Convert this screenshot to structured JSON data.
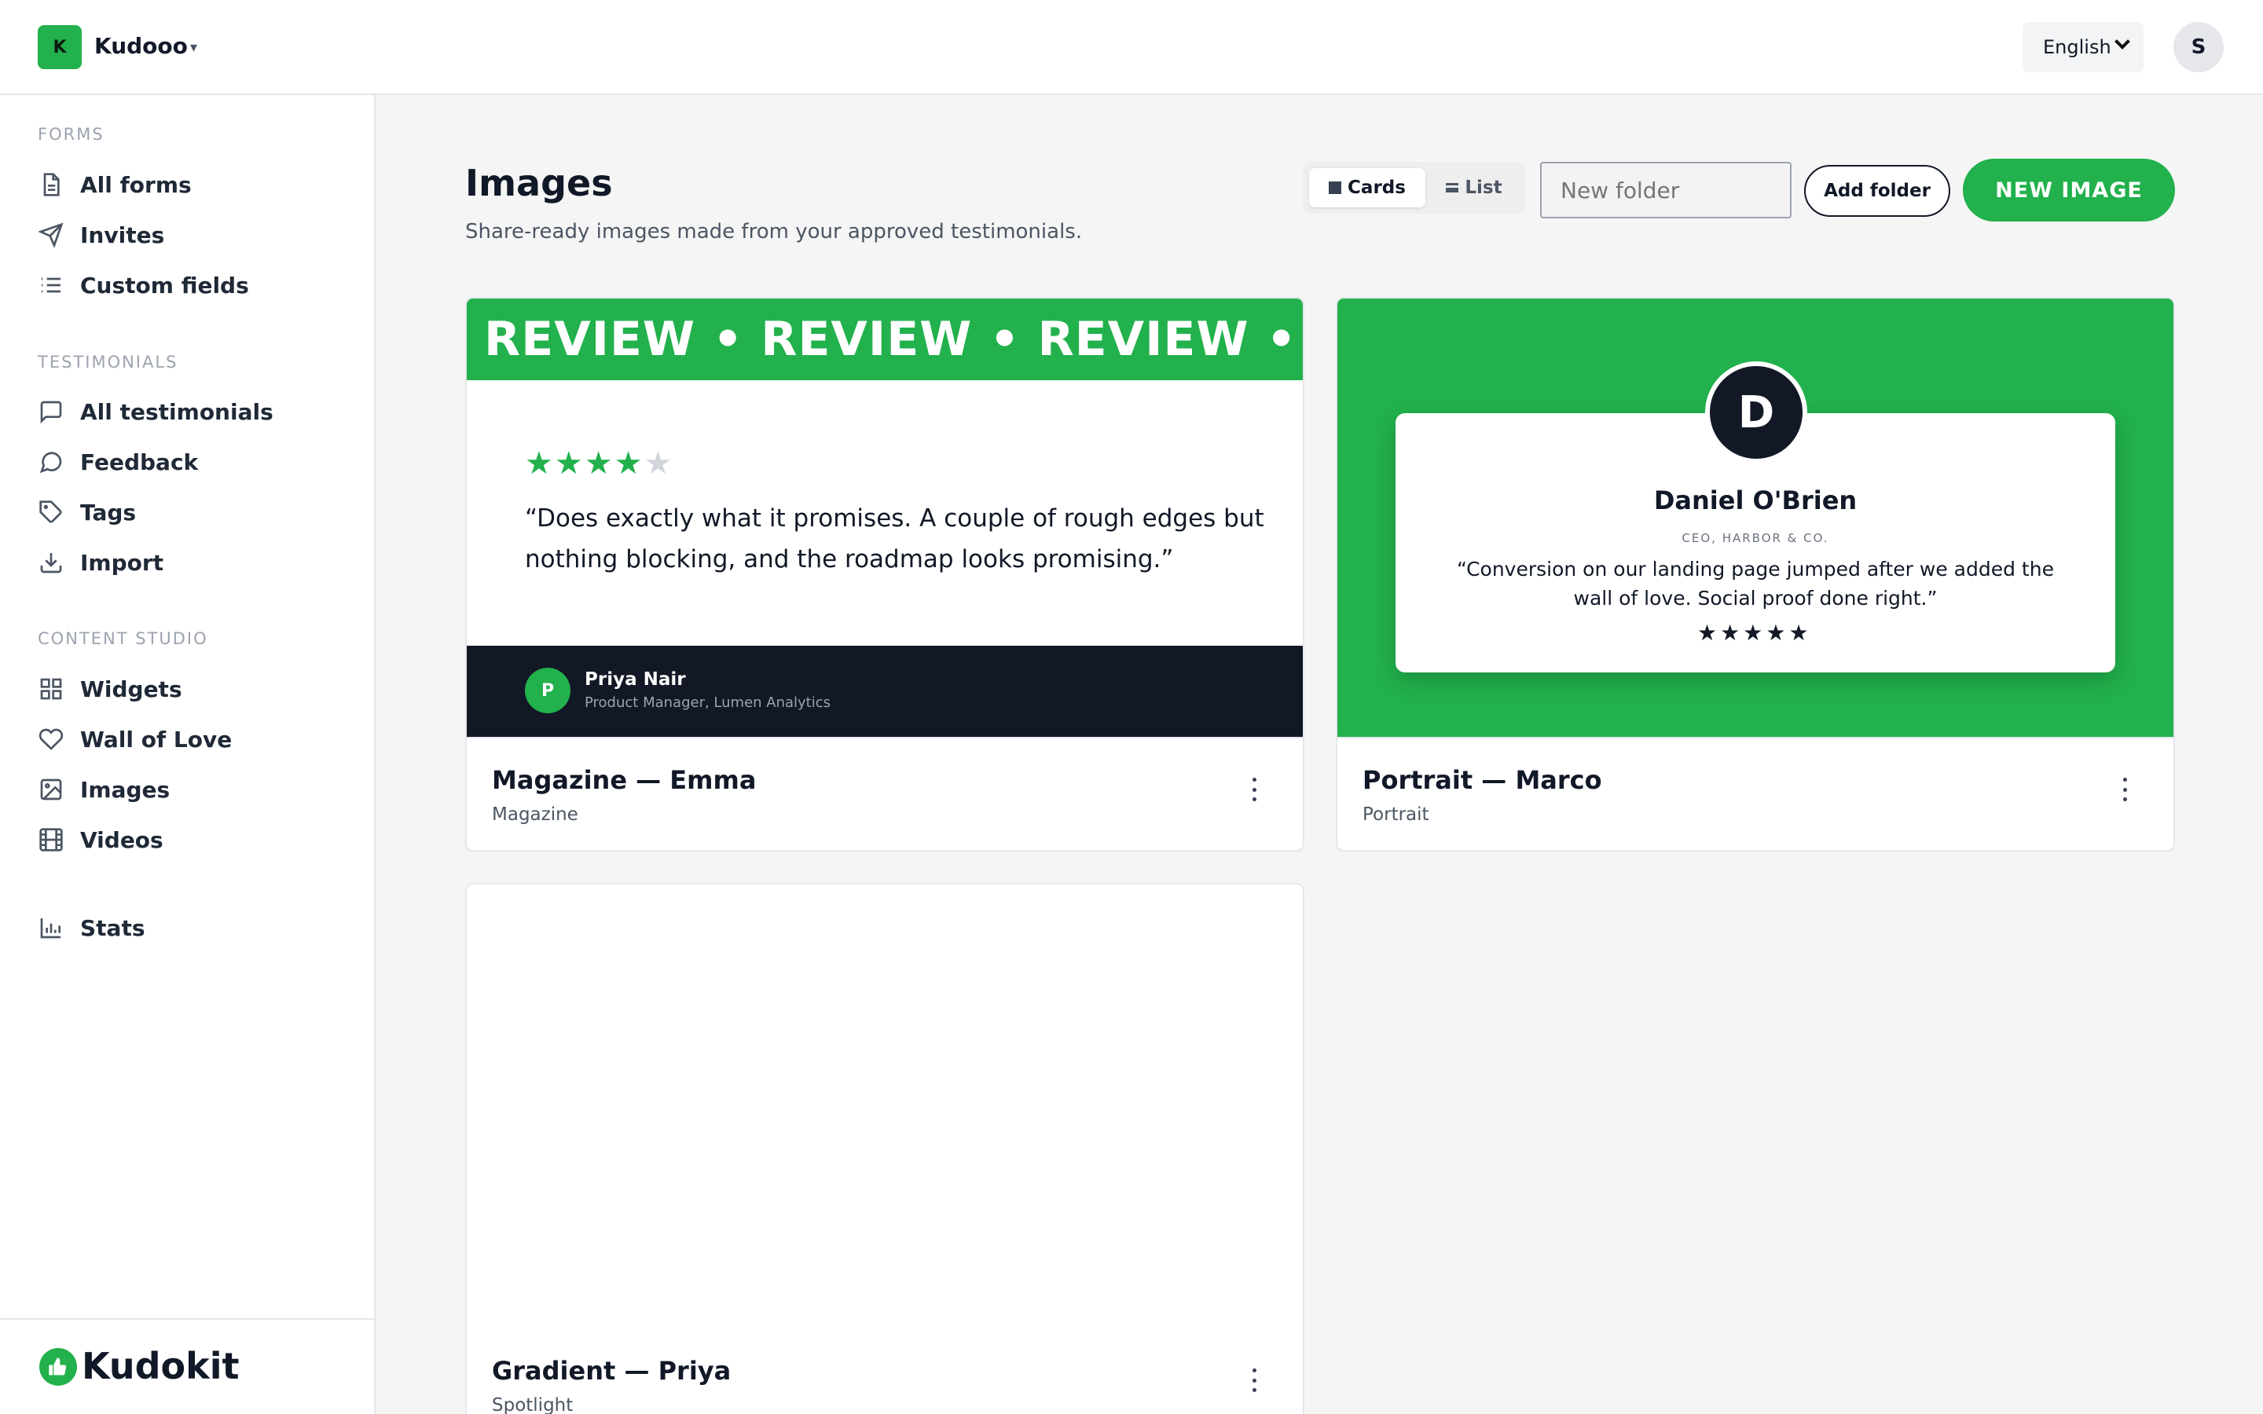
{
  "workspace": {
    "initial": "K",
    "name": "Kudooo",
    "caret": "▾"
  },
  "language": {
    "selected": "English"
  },
  "user": {
    "initial": "S"
  },
  "sidebar": {
    "sections": [
      {
        "title": "FORMS",
        "items": [
          {
            "label": "All forms",
            "icon": "document-icon"
          },
          {
            "label": "Invites",
            "icon": "send-icon"
          },
          {
            "label": "Custom fields",
            "icon": "list-icon"
          }
        ]
      },
      {
        "title": "TESTIMONIALS",
        "items": [
          {
            "label": "All testimonials",
            "icon": "chat-square-icon"
          },
          {
            "label": "Feedback",
            "icon": "chat-round-icon"
          },
          {
            "label": "Tags",
            "icon": "tag-icon"
          },
          {
            "label": "Import",
            "icon": "download-icon"
          }
        ]
      },
      {
        "title": "CONTENT STUDIO",
        "items": [
          {
            "label": "Widgets",
            "icon": "grid-icon"
          },
          {
            "label": "Wall of Love",
            "icon": "heart-icon"
          },
          {
            "label": "Images",
            "icon": "image-icon"
          },
          {
            "label": "Videos",
            "icon": "film-icon"
          }
        ]
      }
    ],
    "stats": {
      "label": "Stats",
      "icon": "bar-chart-icon"
    },
    "brand": {
      "name": "Kudokit"
    }
  },
  "main": {
    "title": "Images",
    "subtitle": "Share-ready images made from your approved testimonials.",
    "view_toggle": {
      "cards": "Cards",
      "list": "List",
      "active": "Cards"
    },
    "folder_input": {
      "placeholder": "New folder"
    },
    "add_folder": "Add folder",
    "new_image": "NEW IMAGE"
  },
  "cards": [
    {
      "title": "Magazine — Emma",
      "type": "Magazine",
      "preview": {
        "band": "REVIEW • REVIEW • REVIEW • REVIEW • REVIEW",
        "rating": 4,
        "max_rating": 5,
        "quote": "“Does exactly what it promises. A couple of rough edges but nothing blocking, and the roadmap looks promising.”",
        "author_initial": "P",
        "author_name": "Priya Nair",
        "author_role": "Product Manager, Lumen Analytics"
      }
    },
    {
      "title": "Portrait — Marco",
      "type": "Portrait",
      "preview": {
        "author_initial": "D",
        "author_name": "Daniel O'Brien",
        "author_role": "CEO, HARBOR & CO.",
        "quote": "“Conversion on our landing page jumped after we added the wall of love. Social proof done right.”",
        "rating": 5,
        "max_rating": 5
      }
    },
    {
      "title": "Gradient — Priya",
      "type": "Spotlight"
    }
  ],
  "colors": {
    "accent": "#22b14c",
    "dark": "#121826",
    "star_empty": "#d1d5db"
  }
}
